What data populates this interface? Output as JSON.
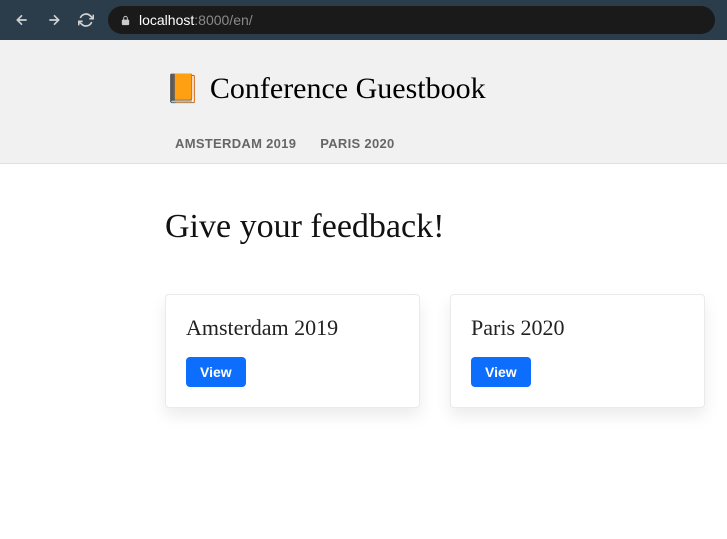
{
  "browser": {
    "url_host": "localhost",
    "url_rest": ":8000/en/"
  },
  "header": {
    "title": "Conference Guestbook",
    "icon": "📙"
  },
  "nav": {
    "items": [
      {
        "label": "AMSTERDAM 2019"
      },
      {
        "label": "PARIS 2020"
      }
    ]
  },
  "main": {
    "heading": "Give your feedback!"
  },
  "cards": [
    {
      "title": "Amsterdam 2019",
      "button": "View"
    },
    {
      "title": "Paris 2020",
      "button": "View"
    }
  ]
}
